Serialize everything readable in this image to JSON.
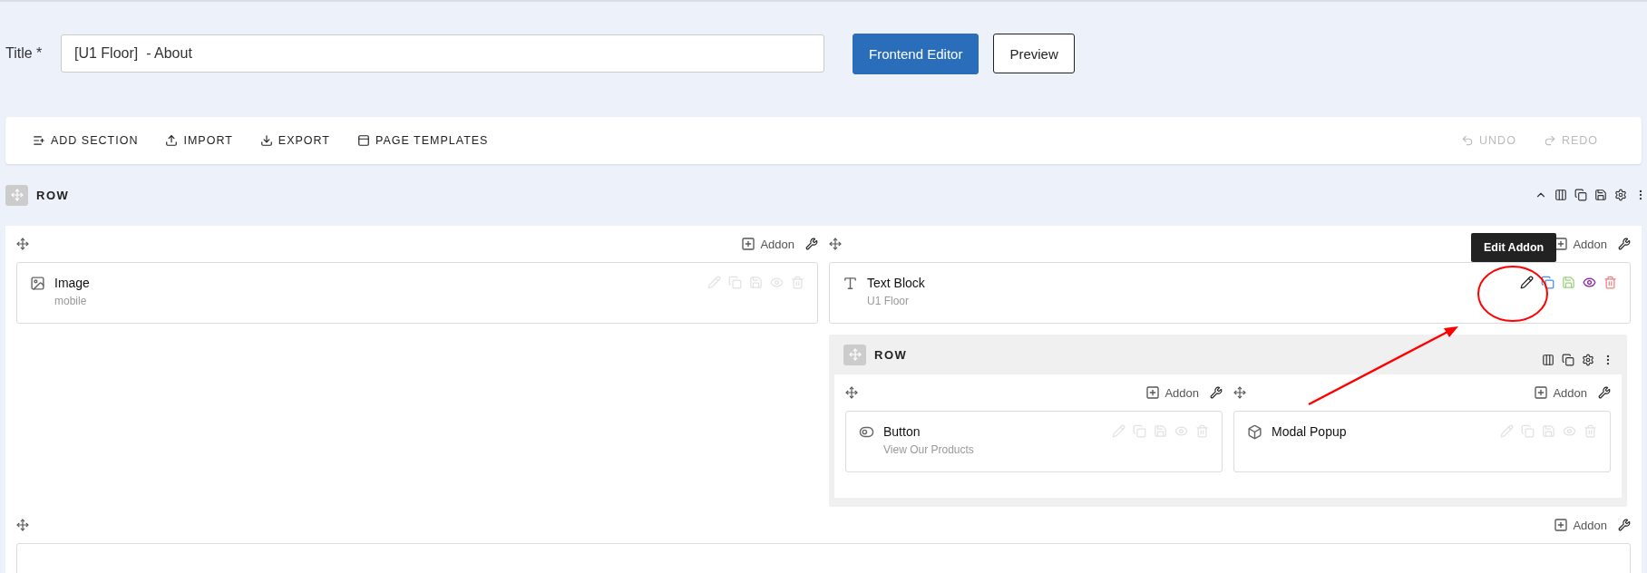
{
  "title_field": {
    "label": "Title *",
    "value": "[U1 Floor]  - About"
  },
  "buttons": [
    {
      "label": "Frontend Editor",
      "kind": "primary"
    },
    {
      "label": "Preview",
      "kind": "outline"
    }
  ],
  "toolbar": {
    "left": [
      {
        "label": "ADD SECTION",
        "kind": "add-section",
        "disabled": false
      },
      {
        "label": "IMPORT",
        "kind": "import",
        "disabled": false
      },
      {
        "label": "EXPORT",
        "kind": "export",
        "disabled": false
      },
      {
        "label": "PAGE TEMPLATES",
        "kind": "templates",
        "disabled": false
      }
    ],
    "right": [
      {
        "label": "UNDO",
        "kind": "undo",
        "disabled": true
      },
      {
        "label": "REDO",
        "kind": "redo",
        "disabled": true
      }
    ]
  },
  "row": {
    "label": "ROW",
    "expanded": true,
    "columns": [
      {
        "addon_label": "Addon",
        "addons": [
          {
            "name": "Image",
            "subtitle": "mobile",
            "kind": "image",
            "highlighted": false
          }
        ]
      },
      {
        "addon_label": "Addon",
        "addons": [
          {
            "name": "Text Block",
            "subtitle": "U1 Floor",
            "kind": "text",
            "highlighted": true,
            "tooltip": "Edit Addon"
          }
        ],
        "rows": [
          {
            "label": "ROW",
            "columns": [
              {
                "addon_label": "Addon",
                "addons": [
                  {
                    "name": "Button",
                    "subtitle": "View Our Products",
                    "kind": "button",
                    "highlighted": false
                  }
                ]
              },
              {
                "addon_label": "Addon",
                "addons": [
                  {
                    "name": "Modal Popup",
                    "kind": "modal",
                    "highlighted": false
                  }
                ]
              }
            ]
          }
        ]
      },
      {
        "addon_label": "Addon"
      }
    ]
  }
}
